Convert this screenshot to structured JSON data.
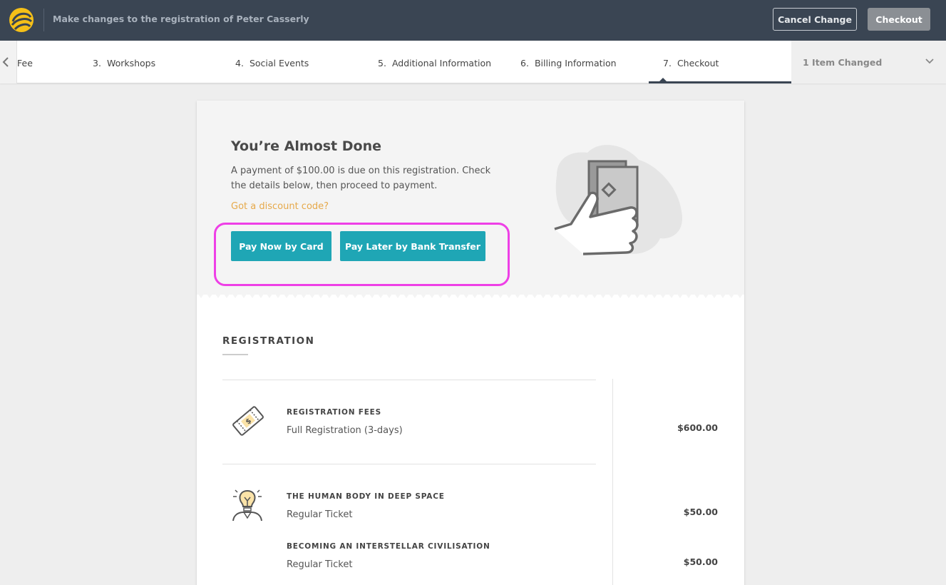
{
  "header": {
    "title": "Make changes to the registration of Peter Casserly",
    "cancel_label": "Cancel Change",
    "checkout_label": "Checkout"
  },
  "steps": [
    {
      "num": "",
      "label": "Fee"
    },
    {
      "num": "3.",
      "label": "Workshops"
    },
    {
      "num": "4.",
      "label": "Social Events"
    },
    {
      "num": "5.",
      "label": "Additional Information"
    },
    {
      "num": "6.",
      "label": "Billing Information"
    },
    {
      "num": "7.",
      "label": "Checkout"
    }
  ],
  "changes": {
    "label": "1 Item Changed"
  },
  "payment": {
    "heading": "You’re Almost Done",
    "description": "A payment of $100.00 is due on this registration. Check the details below, then proceed to payment.",
    "discount_link": "Got a discount code?",
    "pay_card_label": "Pay Now by Card",
    "pay_bank_label": "Pay Later by Bank Transfer"
  },
  "registration": {
    "title": "REGISTRATION",
    "items": [
      {
        "icon": "ticket-icon",
        "title": "REGISTRATION FEES",
        "subtitle": "Full Registration (3-days)",
        "price": "$600.00"
      },
      {
        "icon": "lightbulb-person-icon",
        "title": "THE HUMAN BODY IN DEEP SPACE",
        "subtitle": "Regular Ticket",
        "price": "$50.00"
      },
      {
        "icon": "",
        "title": "BECOMING AN INTERSTELLAR CIVILISATION",
        "subtitle": "Regular Ticket",
        "price": "$50.00"
      }
    ]
  },
  "colors": {
    "topbar": "#3a4553",
    "accent": "#1fa6b5",
    "discount": "#e6a94a",
    "highlight": "#ee3fe6",
    "logo": "#f5c018"
  }
}
